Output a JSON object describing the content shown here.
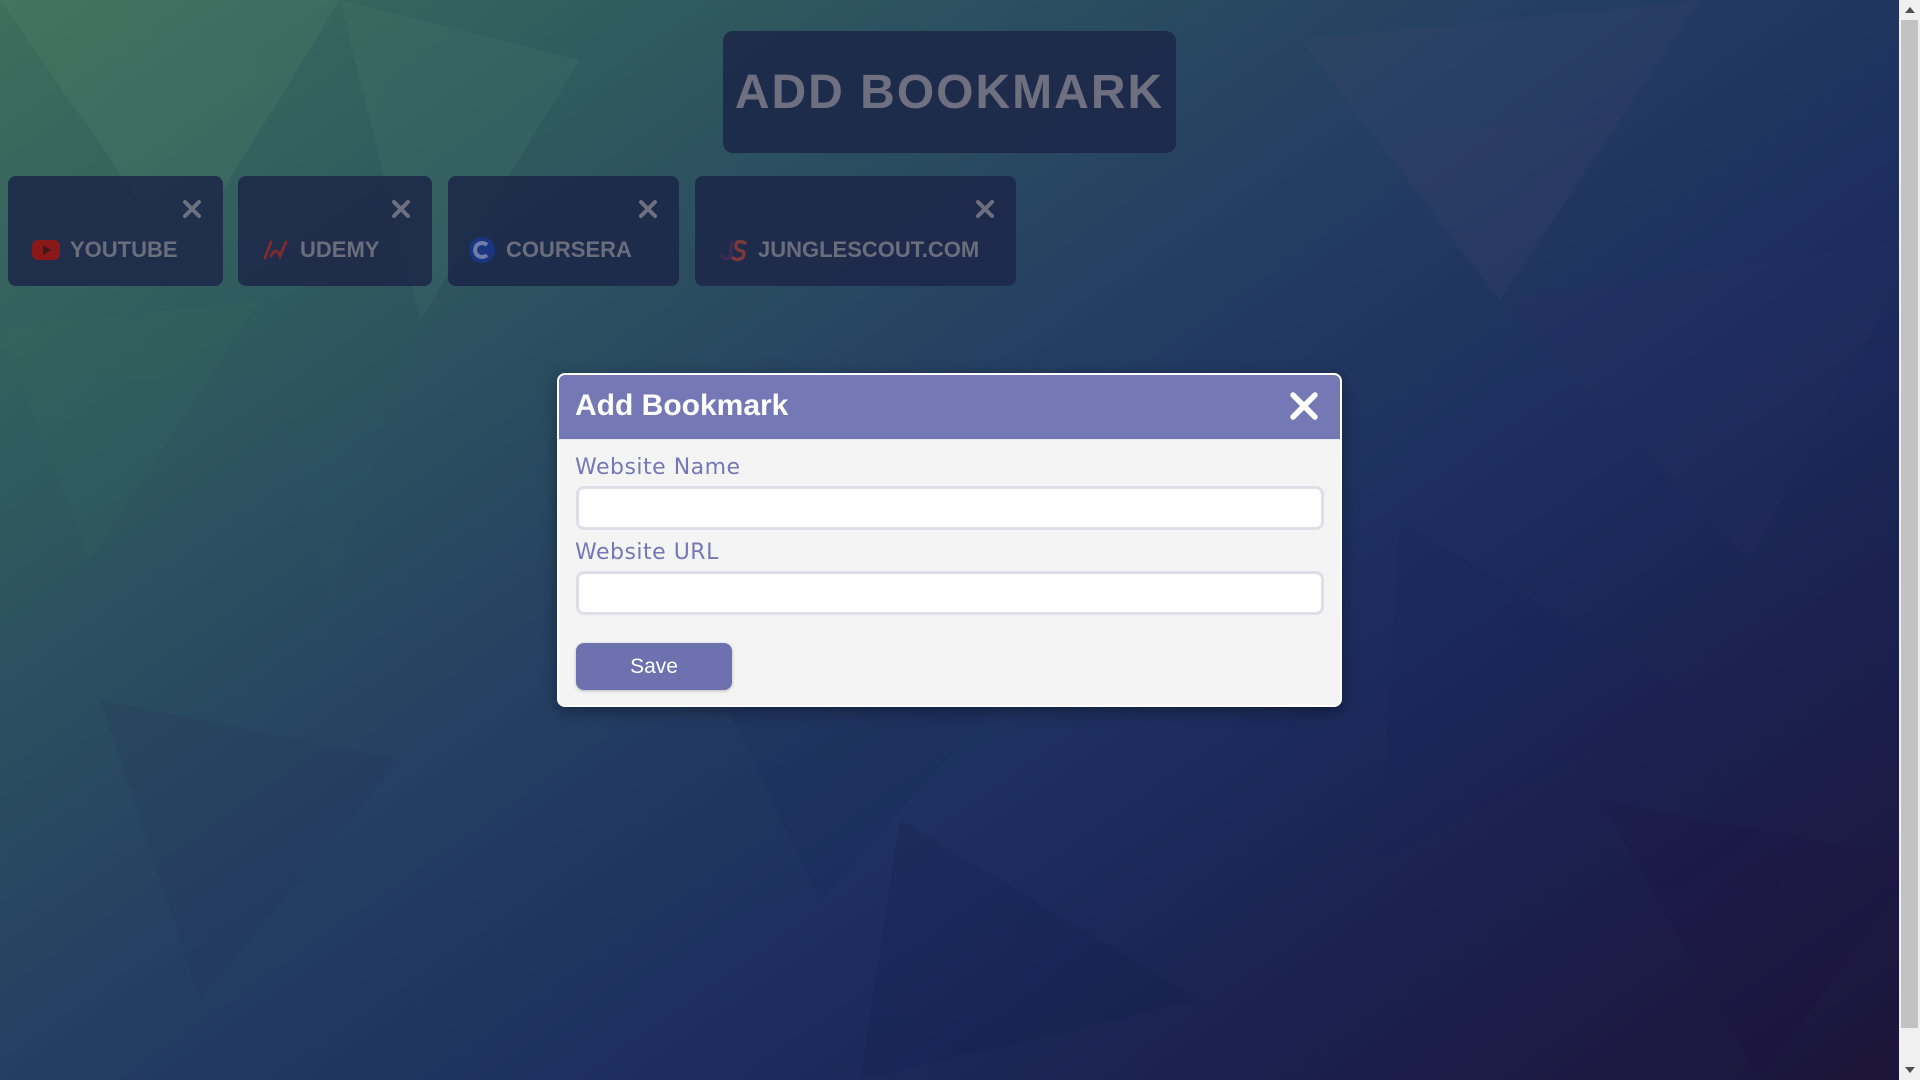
{
  "header": {
    "add_button_label": "ADD BOOKMARK"
  },
  "bookmarks": [
    {
      "label": "YOUTUBE",
      "icon": "youtube-icon"
    },
    {
      "label": "UDEMY",
      "icon": "udemy-icon"
    },
    {
      "label": "COURSERA",
      "icon": "coursera-icon"
    },
    {
      "label": "JUNGLESCOUT.COM",
      "icon": "junglescout-icon"
    }
  ],
  "modal": {
    "title": "Add Bookmark",
    "name_label": "Website Name",
    "name_value": "",
    "url_label": "Website URL",
    "url_value": "",
    "save_label": "Save"
  },
  "colors": {
    "accent": "#7478b5",
    "save_button": "#6d71b0",
    "card_background": "#1c2648"
  }
}
